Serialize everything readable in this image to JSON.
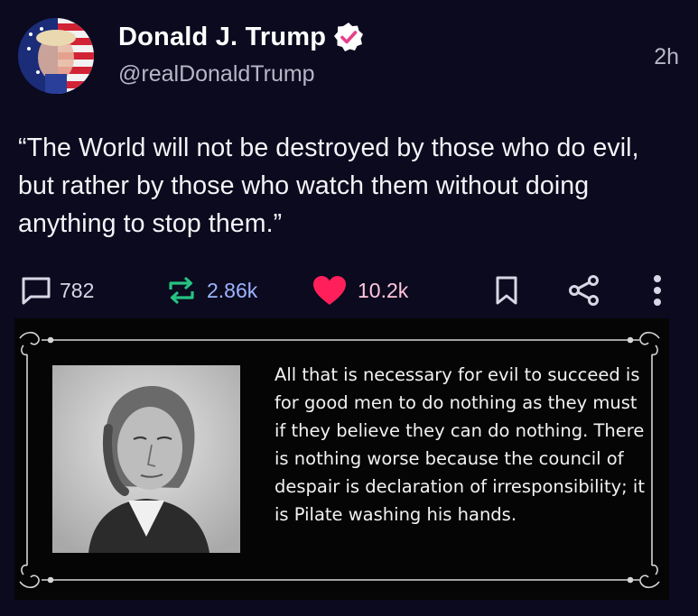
{
  "author": {
    "display_name": "Donald J. Trump",
    "handle": "@realDonaldTrump",
    "verified_icon": "verified-badge-icon",
    "verified_color": "#e63f8a"
  },
  "time": "2h",
  "text": "“The World will not be destroyed by those who do evil, but rather by those who watch them without doing anything to stop them.”",
  "actions": {
    "replies": "782",
    "reposts": "2.86k",
    "likes": "10.2k",
    "reply_icon": "comment-icon",
    "repost_icon": "repost-icon",
    "like_icon": "heart-icon",
    "bookmark_icon": "bookmark-icon",
    "share_icon": "share-icon",
    "more_icon": "more-vertical-icon"
  },
  "media": {
    "quote": "All that is necessary for evil to succeed is for good men to do nothing as they must if they believe they can do nothing. There is nothing worse because the council of despair is declaration of irresponsibility; it is Pilate washing his hands."
  },
  "colors": {
    "background": "#0b0a1e",
    "repost_count": "#9db5ff",
    "like_heart": "#ff1f5a",
    "like_count": "#ffc6dc"
  }
}
